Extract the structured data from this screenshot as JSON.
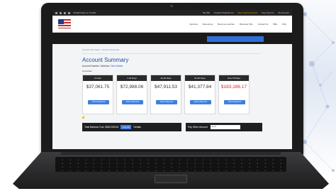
{
  "topbar": {
    "left_text": "Info@Charge.on Credits",
    "center_text": "",
    "links": [
      "Pay Bill",
      "Contact Products Co",
      "Pay Credit Card Acct",
      "Pay Card Co",
      "My Account"
    ]
  },
  "nav": {
    "brand": "",
    "menu": [
      "Services",
      "Resources",
      "Become a partner",
      "Business Tips",
      "Contact Us",
      "Bills",
      "FAQ"
    ]
  },
  "hero": {
    "box_line1": "",
    "box_line2": ""
  },
  "breadcrumb": "Account Summary > Account Summary",
  "title": "Account Summary",
  "account": {
    "label": "Account Number / Address:",
    "link": "View Details"
  },
  "section_label": "Financials",
  "cards": [
    {
      "head": "Current",
      "amount": "$37,061.75",
      "sub": "",
      "button": "Add to Payment",
      "red": false
    },
    {
      "head": "1-30 Days",
      "amount": "$72,988.06",
      "sub": "",
      "button": "Add to Payment",
      "red": false
    },
    {
      "head": "31-60 Days",
      "amount": "$47,911.53",
      "sub": "",
      "button": "Add to Payment",
      "red": false
    },
    {
      "head": "61-90 Days",
      "amount": "$41,377.84",
      "sub": "",
      "button": "Add to Payment",
      "red": false
    },
    {
      "head": "Over 90 Days",
      "amount": "$183,186.17",
      "sub": "",
      "button": "Add to Payment",
      "red": true
    }
  ],
  "note": "",
  "total": {
    "label": "Total Balance Due: $383,535.60",
    "pay": "Pay All",
    "extra": "Details"
  },
  "other": {
    "label": "Pay Other Amount",
    "placeholder": "$0.00"
  },
  "colors": {
    "accent": "#3f7fe0",
    "title_blue": "#1e4c91",
    "alert_red": "#d32626"
  }
}
